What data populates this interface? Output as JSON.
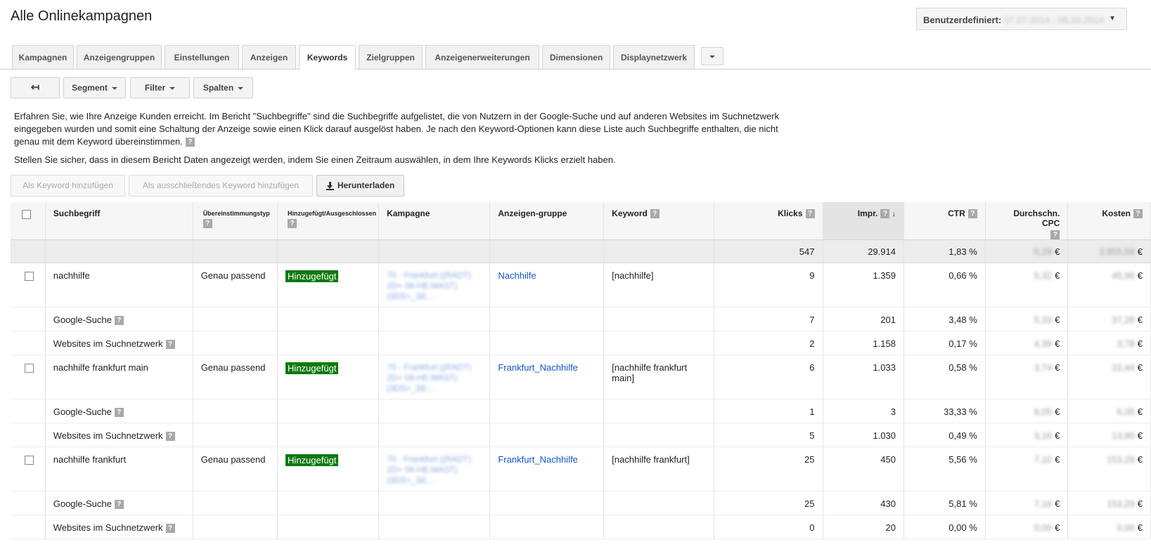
{
  "header": {
    "title": "Alle Onlinekampagnen",
    "date_label": "Benutzerdefiniert:",
    "date_value": "07.07.2014 - 06.10.2014"
  },
  "tabs": [
    "Kampagnen",
    "Anzeigengruppen",
    "Einstellungen",
    "Anzeigen",
    "Keywords",
    "Zielgruppen",
    "Anzeigenerweiterungen",
    "Dimensionen",
    "Displaynetzwerk"
  ],
  "active_tab": "Keywords",
  "toolbar": {
    "back_icon": "back-arrow-icon",
    "segment": "Segment",
    "filter": "Filter",
    "columns": "Spalten"
  },
  "info": {
    "text": "Erfahren Sie, wie Ihre Anzeige Kunden erreicht. Im Bericht \"Suchbegriffe\" sind die Suchbegriffe aufgelistet, die von Nutzern in der Google-Suche und auf anderen Websites im Suchnetzwerk eingegeben wurden und somit eine Schaltung der Anzeige sowie einen Klick darauf ausgelöst haben. Je nach den Keyword-Optionen kann diese Liste auch Suchbegriffe enthalten, die nicht genau mit dem Keyword übereinstimmen.",
    "text2": "Stellen Sie sicher, dass in diesem Bericht Daten angezeigt werden, indem Sie einen Zeitraum auswählen, in dem Ihre Keywords Klicks erzielt haben."
  },
  "actions": {
    "add_keyword": "Als Keyword hinzufügen",
    "add_negative": "Als ausschließendes Keyword hinzufügen",
    "download": "Herunterladen"
  },
  "help_glyph": "?",
  "currency": "€",
  "table": {
    "columns": {
      "search_term": "Suchbegriff",
      "match_type": "Übereinstimmungstyp",
      "added_excluded": "Hinzugefügt/Ausgeschlossen",
      "campaign": "Kampagne",
      "ad_group": "Anzeigen-gruppe",
      "keyword": "Keyword",
      "clicks": "Klicks",
      "impressions": "Impr.",
      "ctr": "CTR",
      "avg_cpc": "Durchschn. CPC",
      "cost": "Kosten"
    },
    "total": {
      "clicks": "547",
      "impressions": "29.914",
      "ctr": "1,83 %",
      "avg_cpc": "0,29",
      "cost": "3.955,59"
    },
    "rows": [
      {
        "term": "nachhilfe",
        "match": "Genau passend",
        "status": "Hinzugefügt",
        "campaign": "70 - Frankfurt ((RADT) 2D+ 08-HE:MAST) (3DS+_SE…",
        "ad_group": "Nachhilfe",
        "keyword": "[nachhilfe]",
        "clicks": "9",
        "impressions": "1.359",
        "ctr": "0,66 %",
        "cpc": "5,32",
        "cost": "45,96",
        "sub": [
          {
            "label": "Google-Suche",
            "clicks": "7",
            "impressions": "201",
            "ctr": "3,48 %",
            "cpc": "5,33",
            "cost": "37,28"
          },
          {
            "label": "Websites im Suchnetzwerk",
            "clicks": "2",
            "impressions": "1.158",
            "ctr": "0,17 %",
            "cpc": "4,39",
            "cost": "3,78"
          }
        ]
      },
      {
        "term": "nachhilfe frankfurt main",
        "match": "Genau passend",
        "status": "Hinzugefügt",
        "campaign": "70 - Frankfurt ((RADT) 2D+ 08-HE:MAST) (3DS+_SE…",
        "ad_group": "Frankfurt_Nachhilfe",
        "keyword": "[nachhilfe frankfurt main]",
        "clicks": "6",
        "impressions": "1.033",
        "ctr": "0,58 %",
        "cpc": "3,74",
        "cost": "22,44",
        "sub": [
          {
            "label": "Google-Suche",
            "clicks": "1",
            "impressions": "3",
            "ctr": "33,33 %",
            "cpc": "6,05",
            "cost": "6,05"
          },
          {
            "label": "Websites im Suchnetzwerk",
            "clicks": "5",
            "impressions": "1.030",
            "ctr": "0,49 %",
            "cpc": "3,16",
            "cost": "13,90"
          }
        ]
      },
      {
        "term": "nachhilfe frankfurt",
        "match": "Genau passend",
        "status": "Hinzugefügt",
        "campaign": "70 - Frankfurt ((RADT) 2D+ 08-HE:MAST) (3DS+_SE…",
        "ad_group": "Frankfurt_Nachhilfe",
        "keyword": "[nachhilfe frankfurt]",
        "clicks": "25",
        "impressions": "450",
        "ctr": "5,56 %",
        "cpc": "7,10",
        "cost": "153,29",
        "sub": [
          {
            "label": "Google-Suche",
            "clicks": "25",
            "impressions": "430",
            "ctr": "5,81 %",
            "cpc": "7,16",
            "cost": "153,29"
          },
          {
            "label": "Websites im Suchnetzwerk",
            "clicks": "0",
            "impressions": "20",
            "ctr": "0,00 %",
            "cpc": "0,00",
            "cost": "0,00"
          }
        ]
      }
    ]
  }
}
